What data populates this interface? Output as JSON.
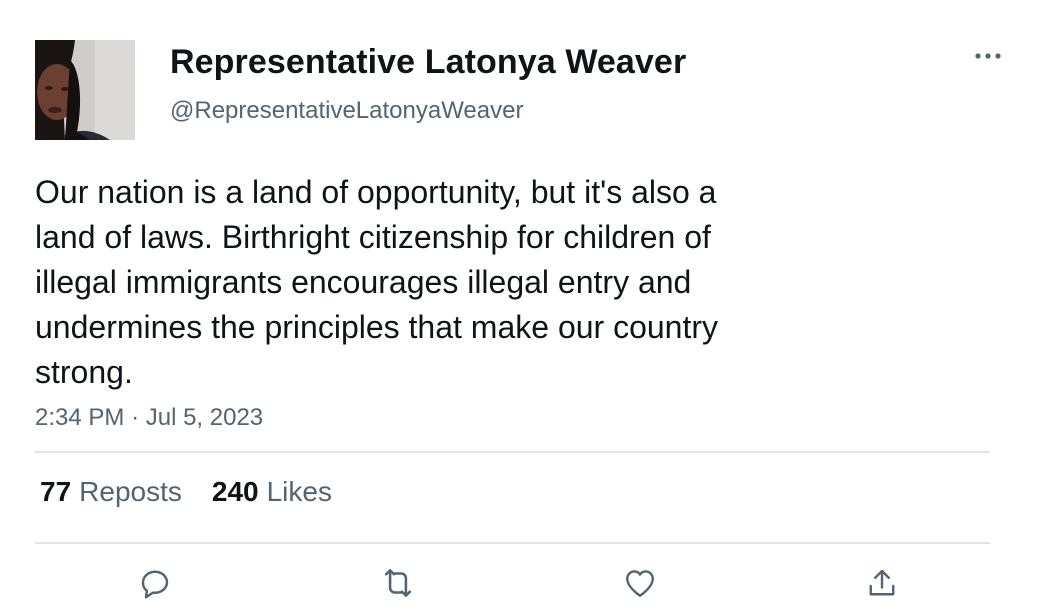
{
  "author": {
    "display_name": "Representative Latonya Weaver",
    "handle": "@RepresentativeLatonyaWeaver",
    "avatar_icon": "profile-photo"
  },
  "tweet": {
    "text": "Our nation is a land of opportunity, but it's also a\nland of laws. Birthright citizenship for children of\nillegal immigrants encourages illegal entry and\nundermines the principles that make our country\nstrong.",
    "time": "2:34 PM",
    "separator": "·",
    "date": "Jul 5, 2023"
  },
  "stats": {
    "reposts_count": "77",
    "reposts_label": "Reposts",
    "likes_count": "240",
    "likes_label": "Likes"
  },
  "actions": [
    "reply-icon",
    "repost-icon",
    "like-icon",
    "share-icon"
  ],
  "more_icon": "more-options-icon",
  "colors": {
    "text_primary": "#0f1419",
    "text_secondary": "#536471",
    "divider": "#e1e3e5",
    "icon": "#536471"
  }
}
